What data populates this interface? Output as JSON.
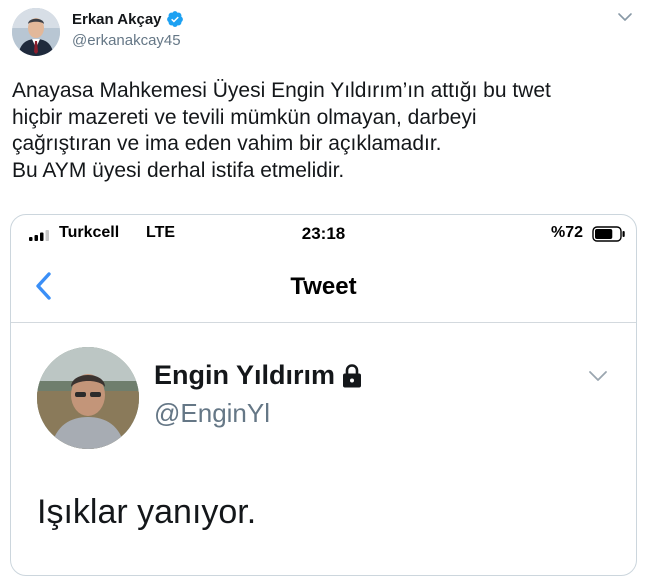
{
  "tweet": {
    "author": {
      "name": "Erkan Akçay",
      "handle": "@erkanakcay45",
      "verified": true
    },
    "text_lines": [
      "Anayasa Mahkemesi Üyesi Engin Yıldırım’ın attığı bu twet",
      "hiçbir mazereti ve tevili mümkün olmayan, darbeyi",
      "çağrıştıran ve ima eden vahim bir açıklamadır.",
      "Bu AYM üyesi derhal istifa etmelidir."
    ],
    "menu_icon": "chevron-down-icon"
  },
  "screenshot": {
    "status_bar": {
      "carrier": "Turkcell",
      "network": "LTE",
      "time": "23:18",
      "battery": "%72",
      "battery_level": 0.72
    },
    "nav": {
      "back_icon": "chevron-left-icon",
      "title": "Tweet"
    },
    "embedded_tweet": {
      "name": "Engin Yıldırım",
      "handle": "@EnginYl",
      "protected_icon": "lock-icon",
      "text": "Işıklar yanıyor.",
      "menu_icon": "chevron-down-icon"
    }
  },
  "colors": {
    "text_primary": "#14171a",
    "text_secondary": "#657786",
    "link_blue": "#1da1f2",
    "ios_blue": "#3a8ff7",
    "border": "#ccd6dd"
  }
}
